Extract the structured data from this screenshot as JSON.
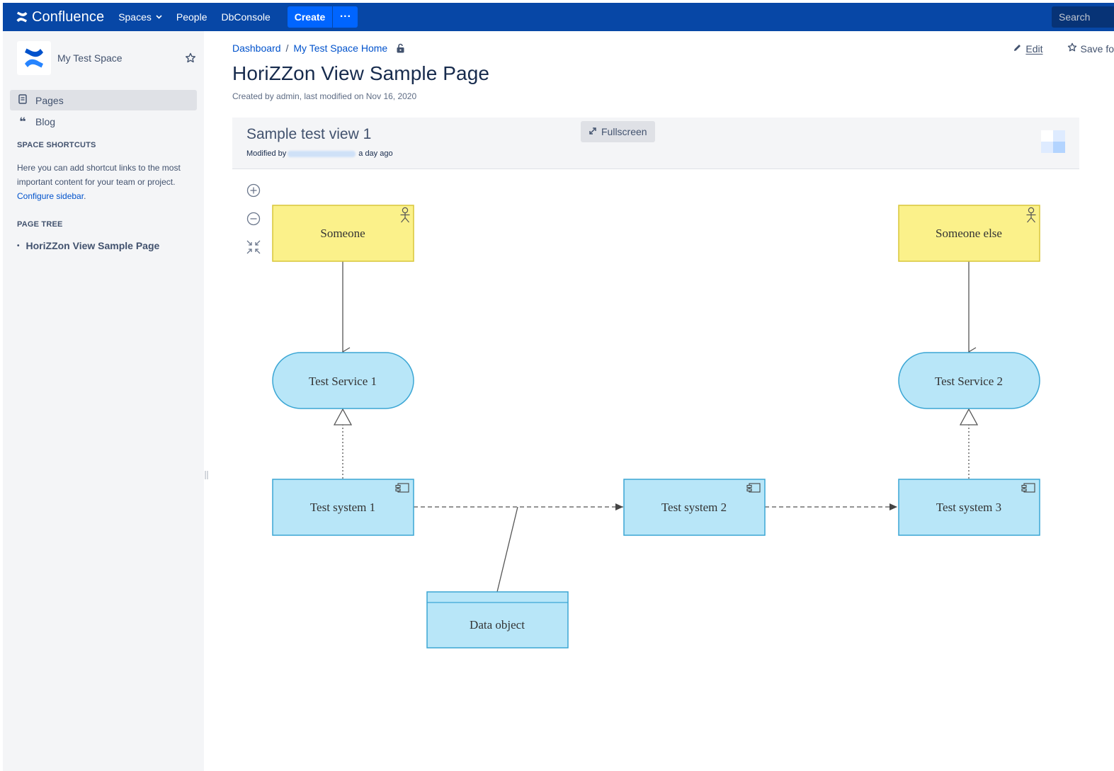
{
  "header": {
    "logo_text": "Confluence",
    "nav": [
      {
        "label": "Spaces",
        "has_dropdown": true
      },
      {
        "label": "People"
      },
      {
        "label": "DbConsole"
      }
    ],
    "create_label": "Create",
    "more_label": "···",
    "search_placeholder": "Search",
    "colors": {
      "bar": "#0747a6",
      "button": "#0065ff"
    }
  },
  "sidebar": {
    "space_name": "My Test Space",
    "items": [
      {
        "label": "Pages",
        "icon": "pages-icon",
        "active": true
      },
      {
        "label": "Blog",
        "icon": "blog-quote-icon",
        "active": false
      }
    ],
    "shortcuts_title": "SPACE SHORTCUTS",
    "shortcuts_text": "Here you can add shortcut links to the most important content for your team or project.",
    "configure_link": "Configure sidebar",
    "configure_suffix": ".",
    "page_tree_title": "PAGE TREE",
    "page_tree_items": [
      "HoriZZon View Sample Page"
    ]
  },
  "page": {
    "breadcrumbs": [
      "Dashboard",
      "My Test Space Home"
    ],
    "breadcrumb_sep": "/",
    "actions": [
      {
        "label": "Edit",
        "icon": "pencil-icon"
      },
      {
        "label": "Save fo",
        "icon": "star-icon"
      }
    ],
    "title": "HoriZZon View Sample Page",
    "meta": "Created by admin, last modified on Nov 16, 2020"
  },
  "view": {
    "title": "Sample test view 1",
    "modified_prefix": "Modified by",
    "modified_suffix": "a day ago",
    "fullscreen_label": "Fullscreen"
  },
  "diagram": {
    "colors": {
      "actor_fill": "#fbf18a",
      "actor_border": "#d8c63a",
      "app_fill": "#b8e6f8",
      "app_border": "#3ba6d4",
      "connector": "#555555"
    },
    "nodes": {
      "someone": "Someone",
      "someone_else": "Someone else",
      "service1": "Test Service 1",
      "service2": "Test Service 2",
      "system1": "Test system 1",
      "system2": "Test system 2",
      "system3": "Test system 3",
      "data_object": "Data object"
    }
  }
}
